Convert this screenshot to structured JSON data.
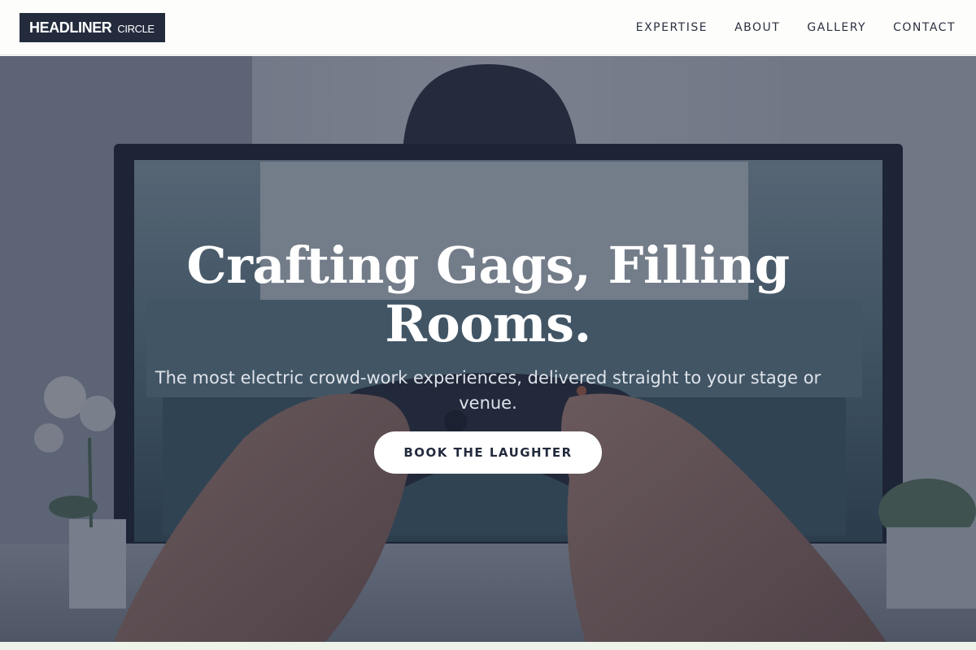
{
  "header": {
    "logo_main": "HEADLINER",
    "logo_sub": "CIRCLE",
    "nav": [
      "EXPERTISE",
      "ABOUT",
      "GALLERY",
      "CONTACT"
    ]
  },
  "hero": {
    "title": "Crafting Gags, Filling Rooms.",
    "subtitle": "The most electric crowd-work experiences, delivered straight to your stage or venue.",
    "cta_label": "BOOK THE LAUGHTER",
    "background_image": "hands-holding-game-controller-in-front-of-monitor"
  },
  "colors": {
    "logo_bg": "#232b3d",
    "nav_text": "#2a3040",
    "header_bg": "#fdfefb",
    "hero_overlay": "#1c243a",
    "cta_bg": "#ffffff",
    "cta_text": "#232b3d"
  }
}
